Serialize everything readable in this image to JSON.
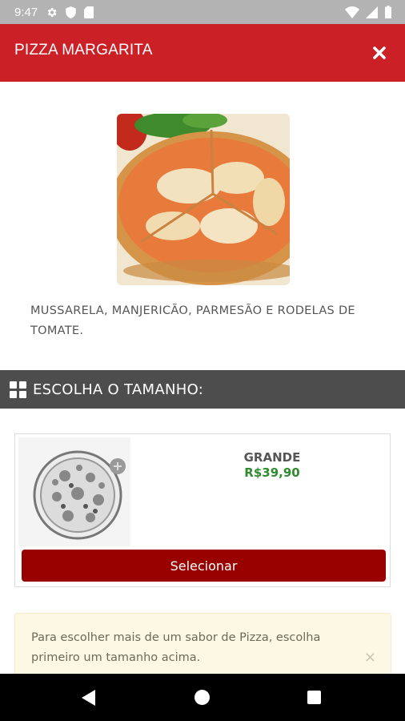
{
  "status_bar": {
    "time": "9:47",
    "left_icons": [
      "gear-icon",
      "shield-icon",
      "sd-card-icon"
    ],
    "right_icons": [
      "wifi-icon",
      "signal-icon",
      "battery-icon"
    ]
  },
  "header": {
    "title": "PIZZA MARGARITA",
    "close_icon": "close-icon",
    "color": "#cc2027"
  },
  "product": {
    "image": "pizza-margarita-image",
    "description": "MUSSARELA, MANJERICÃO, PARMESÃO E RODELAS DE TOMATE."
  },
  "size_section": {
    "icon": "grid-icon",
    "title": "ESCOLHA O TAMANHO:"
  },
  "sizes": [
    {
      "name": "GRANDE",
      "price": "R$39,90",
      "button_label": "Selecionar",
      "button_color": "#990000",
      "price_color": "#2e8b2e"
    }
  ],
  "alert": {
    "text": "Para escolher mais de um sabor de Pizza, escolha primeiro um tamanho acima.",
    "close_label": "×"
  },
  "nav_bar": {
    "icons": [
      "back-icon",
      "home-icon",
      "recent-apps-icon"
    ]
  }
}
